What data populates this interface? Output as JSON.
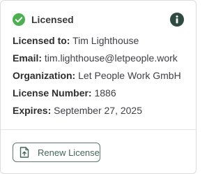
{
  "status": {
    "label": "Licensed",
    "icon": "check-circle-icon",
    "color": "#4caf50"
  },
  "info_icon": "info-icon",
  "fields": {
    "licensed_to": {
      "label": "Licensed to:",
      "value": "Tim Lighthouse"
    },
    "email": {
      "label": "Email:",
      "value": "tim.lighthouse@letpeople.work"
    },
    "organization": {
      "label": "Organization:",
      "value": "Let People Work GmbH"
    },
    "license_number": {
      "label": "License Number:",
      "value": "1886"
    },
    "expires": {
      "label": "Expires:",
      "value": "September 27, 2025"
    }
  },
  "actions": {
    "renew_label": "Renew License",
    "renew_icon": "file-upload-icon",
    "accent": "#44665a"
  }
}
